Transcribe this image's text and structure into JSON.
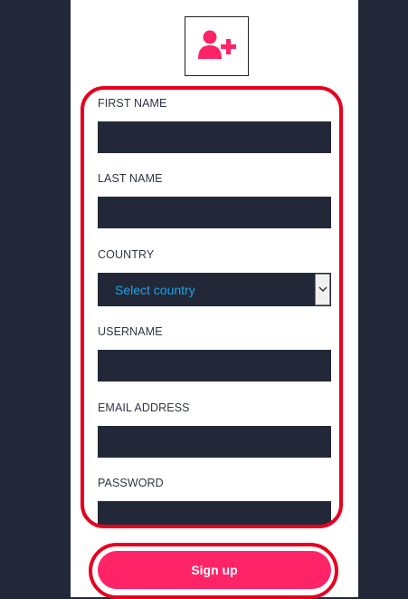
{
  "form": {
    "first_name_label": "FIRST NAME",
    "last_name_label": "LAST NAME",
    "country_label": "COUNTRY",
    "country_selected": "Select country",
    "username_label": "USERNAME",
    "email_label": "EMAIL ADDRESS",
    "password_label": "PASSWORD",
    "first_name_value": "",
    "last_name_value": "",
    "username_value": "",
    "email_value": "",
    "password_value": ""
  },
  "signup": {
    "label": "Sign up"
  },
  "icons": {
    "avatar": "add-user-icon",
    "select": "chevron-down-icon"
  },
  "colors": {
    "background": "#232839",
    "field": "#232839",
    "accent": "#ff2467",
    "highlight": "#e6001f",
    "select_text": "#1aa3e8"
  }
}
